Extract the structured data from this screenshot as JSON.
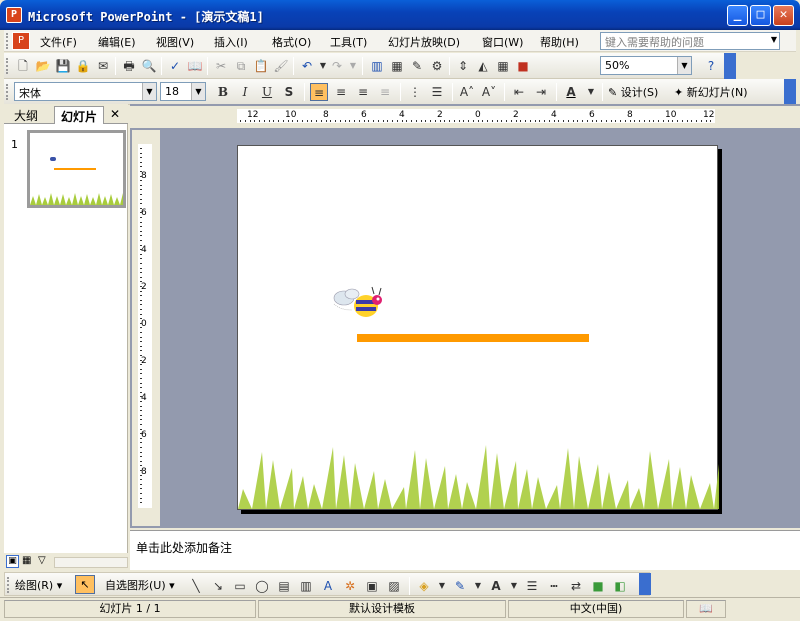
{
  "window": {
    "title": "Microsoft PowerPoint - [演示文稿1]",
    "app_icon": "P"
  },
  "menu": {
    "items": [
      "文件(F)",
      "编辑(E)",
      "视图(V)",
      "插入(I)",
      "格式(O)",
      "工具(T)",
      "幻灯片放映(D)",
      "窗口(W)",
      "帮助(H)"
    ],
    "help_placeholder": "键入需要帮助的问题"
  },
  "standard_toolbar": {
    "zoom": "50%"
  },
  "formatting_toolbar": {
    "font": "宋体",
    "size": "18",
    "bold": "B",
    "italic": "I",
    "underline": "U",
    "shadow": "S",
    "design_label": "设计(S)",
    "new_slide_label": "新幻灯片(N)"
  },
  "left_pane": {
    "tabs": [
      "大纲",
      "幻灯片"
    ],
    "close": "✕",
    "slide_number": "1"
  },
  "ruler": {
    "h_labels": [
      "12",
      "10",
      "8",
      "6",
      "4",
      "2",
      "0",
      "2",
      "4",
      "6",
      "8",
      "10",
      "12"
    ],
    "v_labels": [
      "8",
      "6",
      "4",
      "2",
      "0",
      "2",
      "4",
      "6",
      "8"
    ]
  },
  "notes": {
    "placeholder": "单击此处添加备注"
  },
  "draw_toolbar": {
    "draw_label": "绘图(R)",
    "autoshape_label": "自选图形(U)"
  },
  "status": {
    "slide": "幻灯片 1 / 1",
    "template": "默认设计模板",
    "language": "中文(中国)"
  },
  "colors": {
    "accent": "#ff9a00",
    "grass": "#a8cc3c",
    "titlebar": "#0a5fd8",
    "workspace": "#939aae"
  }
}
